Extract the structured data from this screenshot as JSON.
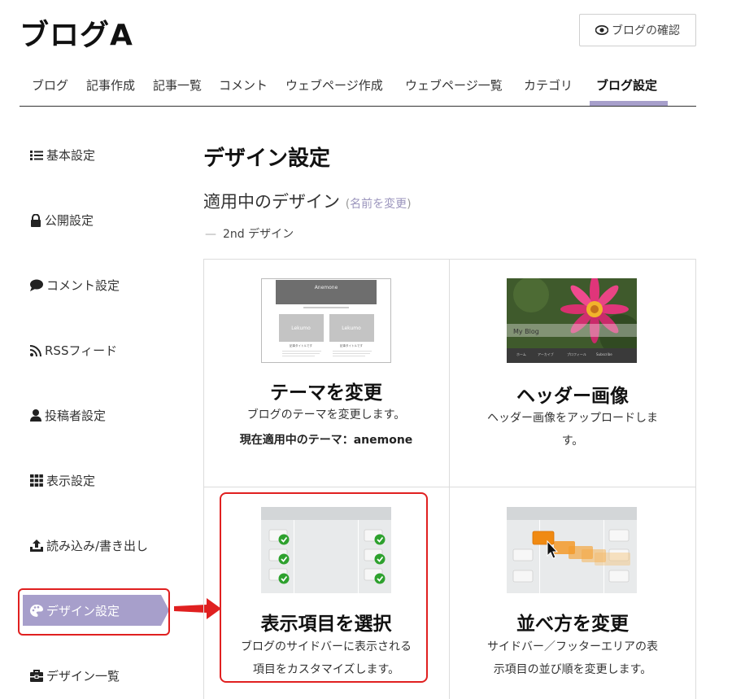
{
  "header": {
    "blog_title": "ブログA",
    "preview_button": "ブログの確認"
  },
  "tabs": [
    {
      "label": "ブログ"
    },
    {
      "label": "記事作成"
    },
    {
      "label": "記事一覧"
    },
    {
      "label": "コメント"
    },
    {
      "label": "ウェブページ作成"
    },
    {
      "label": "ウェブページ一覧"
    },
    {
      "label": "カテゴリ"
    },
    {
      "label": "ブログ設定",
      "active": true
    }
  ],
  "sidebar": {
    "items": [
      {
        "label": "基本設定",
        "icon": "list-icon"
      },
      {
        "label": "公開設定",
        "icon": "lock-icon"
      },
      {
        "label": "コメント設定",
        "icon": "comment-icon"
      },
      {
        "label": "RSSフィード",
        "icon": "rss-icon"
      },
      {
        "label": "投稿者設定",
        "icon": "user-icon"
      },
      {
        "label": "表示設定",
        "icon": "grid-icon"
      },
      {
        "label": "読み込み/書き出し",
        "icon": "upload-icon"
      },
      {
        "label": "デザイン設定",
        "icon": "palette-icon",
        "active": true
      },
      {
        "label": "デザイン一覧",
        "icon": "briefcase-icon"
      }
    ]
  },
  "main": {
    "title": "デザイン設定",
    "applied_heading": "適用中のデザイン",
    "rename_open": "(",
    "rename_link": "名前を変更",
    "rename_close": ")",
    "current_design_dash": "—",
    "current_design_name": "2nd デザイン",
    "cards": [
      {
        "title": "テーマを変更",
        "desc": "ブログのテーマを変更します。",
        "extra": "現在適用中のテーマ：anemone",
        "thumb": {
          "name": "Anemone",
          "box_text": "Lekumo",
          "post_title": "記事タイトルです"
        }
      },
      {
        "title": "ヘッダー画像",
        "desc_lines": [
          "ヘッダー画像をアップロードしま",
          "す。"
        ],
        "thumb": {
          "overlay_text": "My Blog",
          "nav": [
            "ホーム",
            "アーカイブ",
            "プロフィール",
            "Subscribe"
          ]
        }
      },
      {
        "title": "表示項目を選択",
        "desc_lines": [
          "ブログのサイドバーに表示される",
          "項目をカスタマイズします。"
        ]
      },
      {
        "title": "並べ方を変更",
        "desc_lines": [
          "サイドバー／フッターエリアの表",
          "示項目の並び順を変更します。"
        ]
      }
    ]
  },
  "colors": {
    "accent": "#a79fcb",
    "highlight_red": "#e02020",
    "check_green": "#2ea12e",
    "drag_orange": "#f39c12"
  }
}
